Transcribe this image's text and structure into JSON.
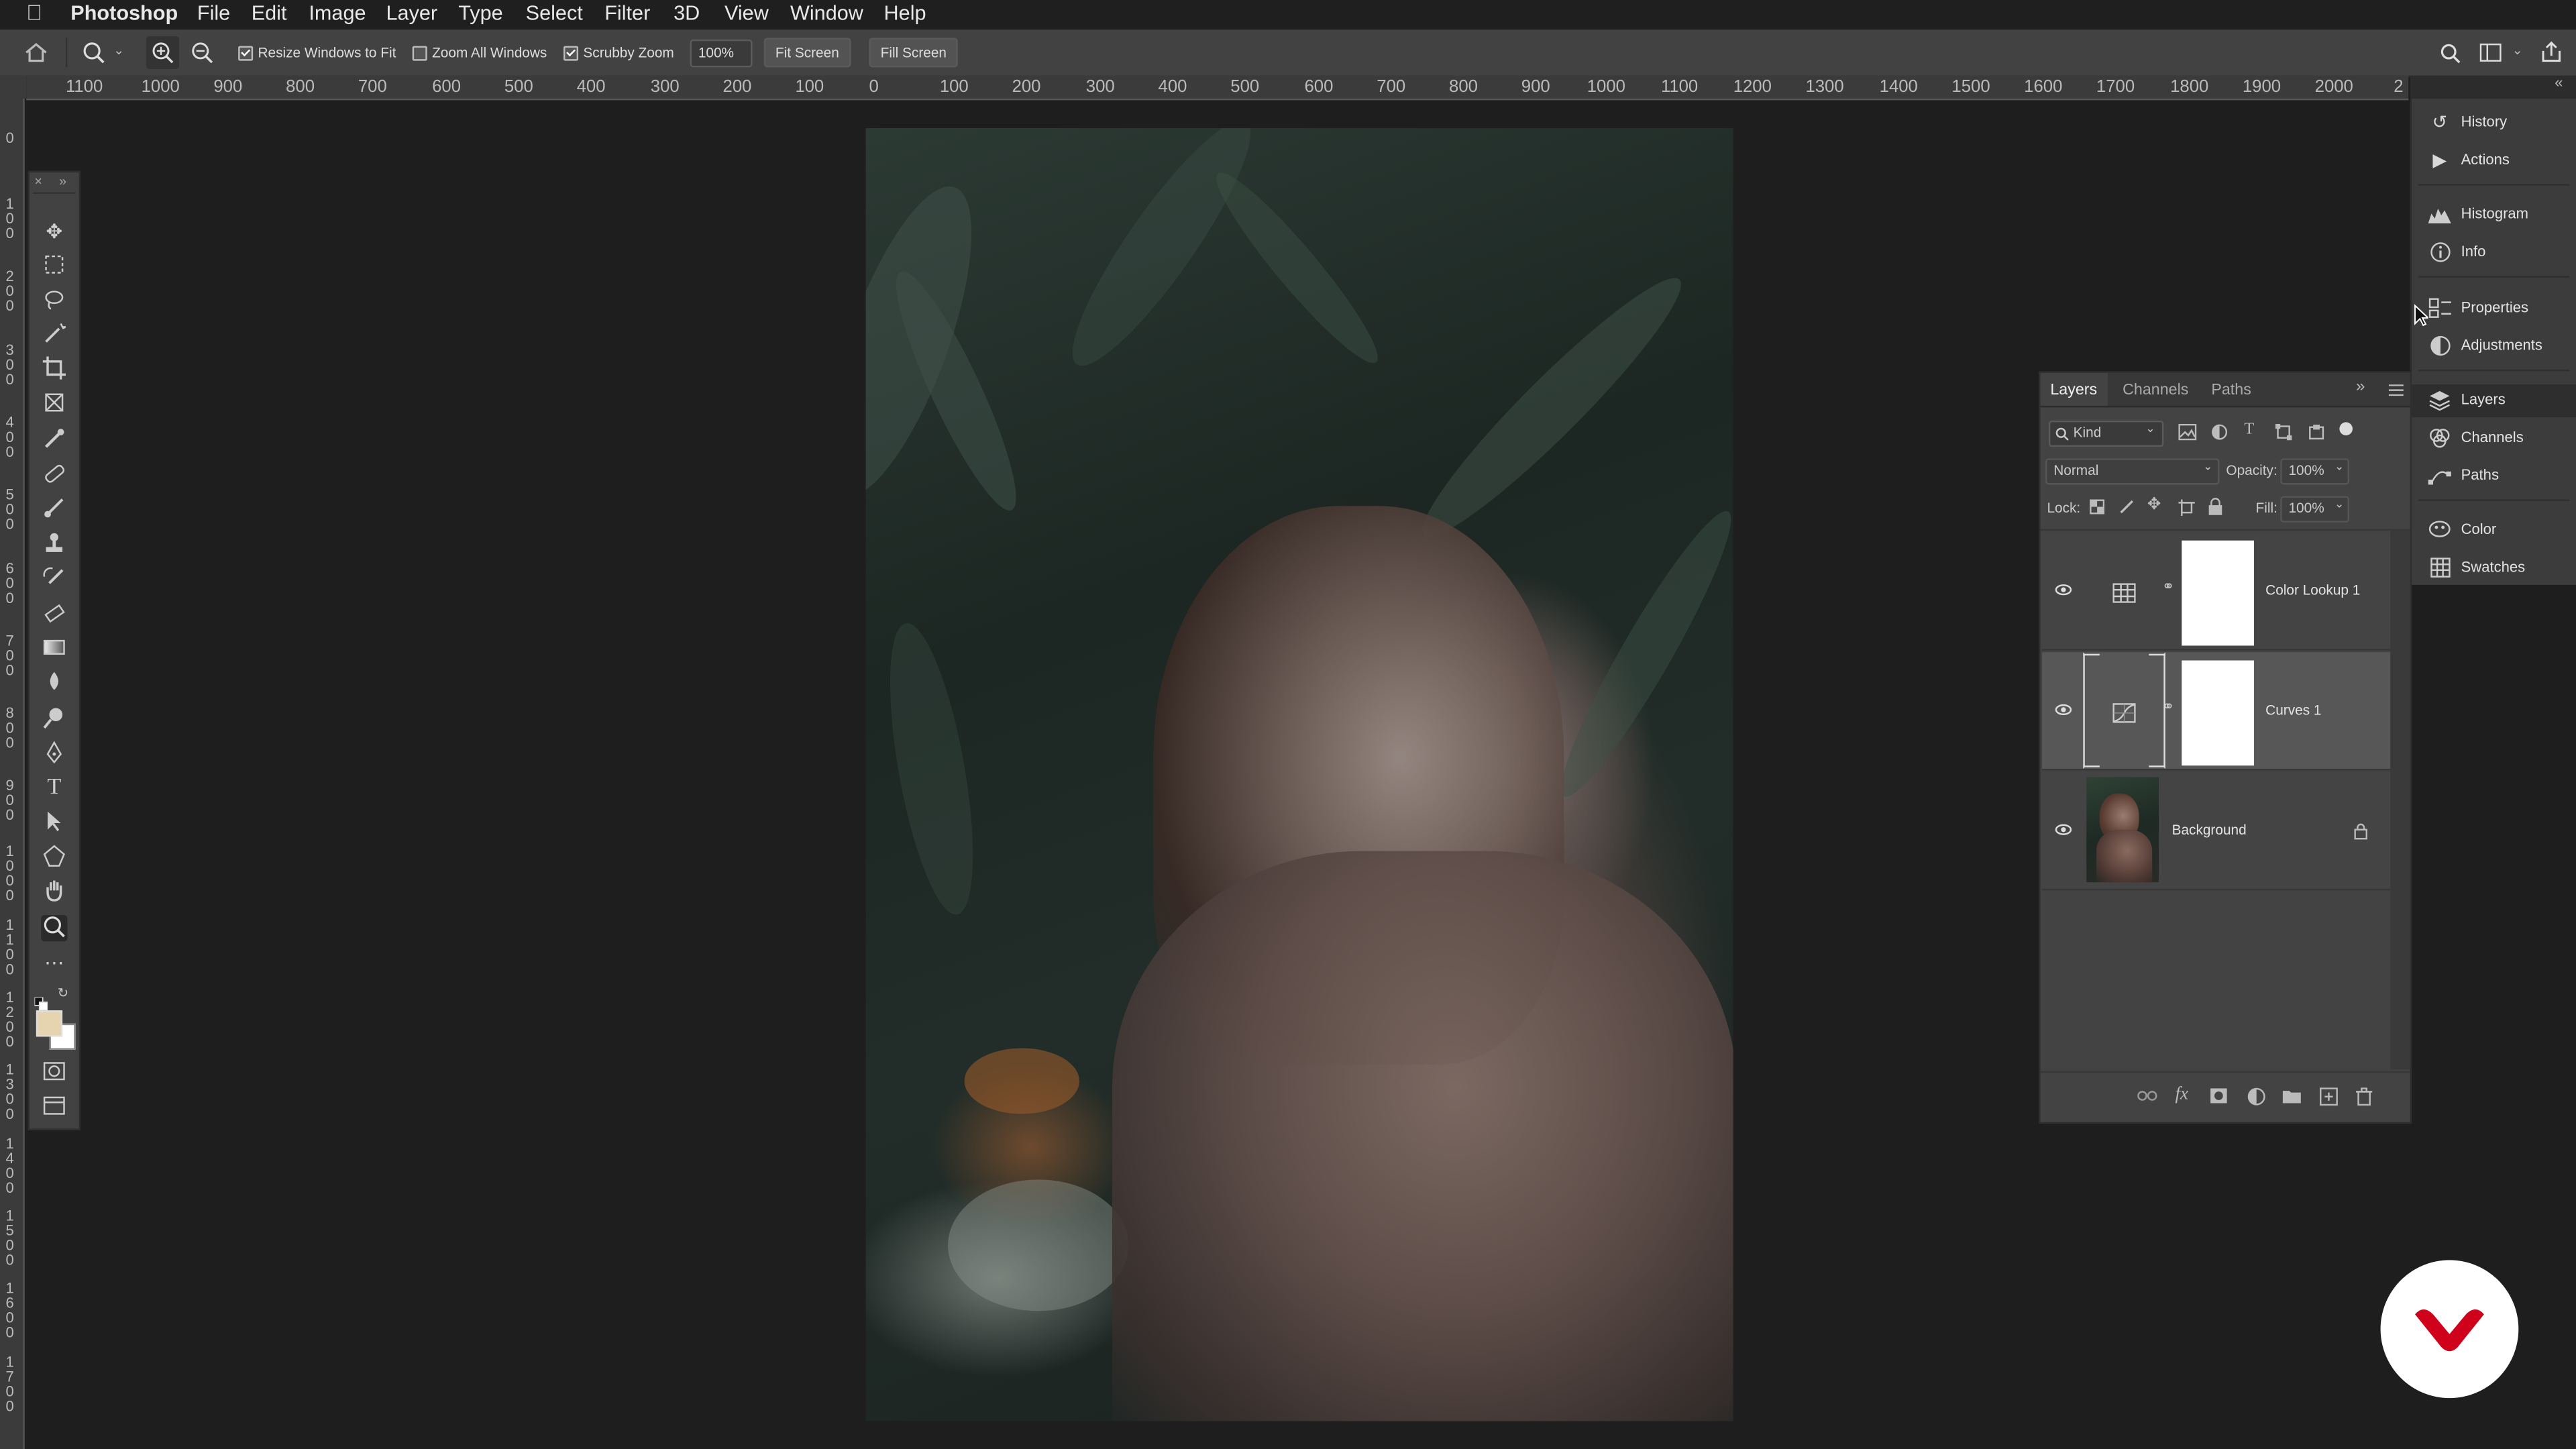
{
  "menubar": {
    "app": "Photoshop",
    "items": [
      "File",
      "Edit",
      "Image",
      "Layer",
      "Type",
      "Select",
      "Filter",
      "3D",
      "View",
      "Window",
      "Help"
    ]
  },
  "options_bar": {
    "resize_windows": "Resize Windows to Fit",
    "zoom_all": "Zoom All Windows",
    "scrubby": "Scrubby Zoom",
    "zoom_value": "100%",
    "fit_screen": "Fit Screen",
    "fill_screen": "Fill Screen"
  },
  "ruler_h": [
    "1100",
    "1000",
    "900",
    "800",
    "700",
    "600",
    "500",
    "400",
    "300",
    "200",
    "100",
    "0",
    "100",
    "200",
    "300",
    "400",
    "500",
    "600",
    "700",
    "800",
    "900",
    "1000",
    "1100",
    "1200",
    "1300",
    "1400",
    "1500",
    "1600",
    "1700",
    "1800",
    "1900",
    "2000",
    "2"
  ],
  "ruler_v": [
    "0",
    "1\n0\n0",
    "2\n0\n0",
    "3\n0\n0",
    "4\n0\n0",
    "5\n0\n0",
    "6\n0\n0",
    "7\n0\n0",
    "8\n0\n0",
    "9\n0\n0",
    "1\n0\n0\n0",
    "1\n1\n0\n0",
    "1\n2\n0\n0",
    "1\n3\n0\n0",
    "1\n4\n0\n0",
    "1\n5\n0\n0",
    "1\n6\n0\n0",
    "1\n7\n0\n0"
  ],
  "dock": {
    "history": "History",
    "actions": "Actions",
    "histogram": "Histogram",
    "info": "Info",
    "properties": "Properties",
    "adjustments": "Adjustments",
    "layers": "Layers",
    "channels": "Channels",
    "paths": "Paths",
    "color": "Color",
    "swatches": "Swatches"
  },
  "layers_panel": {
    "tabs": [
      "Layers",
      "Channels",
      "Paths"
    ],
    "filter_kind": "Kind",
    "blend_mode": "Normal",
    "opacity_label": "Opacity:",
    "opacity_value": "100%",
    "lock_label": "Lock:",
    "fill_label": "Fill:",
    "fill_value": "100%",
    "layers": [
      {
        "name": "Color Lookup 1",
        "type": "adjustment"
      },
      {
        "name": "Curves 1",
        "type": "adjustment",
        "selected": true
      },
      {
        "name": "Background",
        "type": "image",
        "locked": true
      }
    ]
  },
  "colors": {
    "foreground": "#e6d3b0",
    "background": "#ffffff",
    "badge_red": "#d0021b"
  }
}
